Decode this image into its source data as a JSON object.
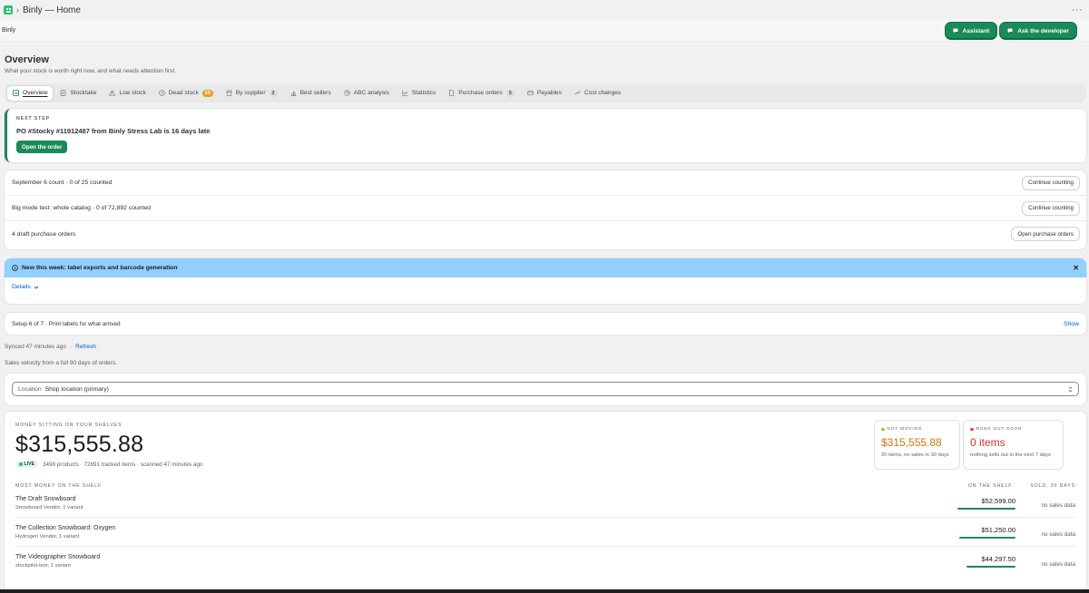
{
  "window": {
    "title": "Binly — Home"
  },
  "appbar": {
    "name": "Binly",
    "assistant_label": "Assistant",
    "developer_label": "Ask the developer"
  },
  "page": {
    "title": "Overview",
    "subtitle": "What your stock is worth right now, and what needs attention first."
  },
  "tabs": [
    {
      "label": "Overview",
      "icon": "overview-icon",
      "active": true
    },
    {
      "label": "Stocktake",
      "icon": "clipboard-icon"
    },
    {
      "label": "Low stock",
      "icon": "alert-triangle-icon"
    },
    {
      "label": "Dead stock",
      "icon": "clock-icon",
      "badge": "20"
    },
    {
      "label": "By supplier",
      "icon": "store-icon",
      "badge": "2"
    },
    {
      "label": "Best sellers",
      "icon": "bar-chart-icon"
    },
    {
      "label": "ABC analysis",
      "icon": "pie-icon"
    },
    {
      "label": "Statistics",
      "icon": "stats-icon"
    },
    {
      "label": "Purchase orders",
      "icon": "document-icon",
      "badge": "5"
    },
    {
      "label": "Payables",
      "icon": "wallet-icon"
    },
    {
      "label": "Cost changes",
      "icon": "trend-icon"
    }
  ],
  "next_step": {
    "label": "NEXT STEP",
    "title": "PO #Stocky #11912487 from Binly Stress Lab is 16 days late",
    "button": "Open the order"
  },
  "tasks": [
    {
      "text": "September 6 count · 0 of 25 counted",
      "button": "Continue counting"
    },
    {
      "text": "Big mode test: whole catalog · 0 of 72,892 counted",
      "button": "Continue counting"
    },
    {
      "text": "4 draft purchase orders",
      "button": "Open purchase orders"
    }
  ],
  "banner": {
    "title": "New this week: label exports and barcode generation",
    "details": "Details"
  },
  "setup": {
    "text": "Setup 6 of 7 · Print labels for what arrived",
    "show": "Show"
  },
  "sync": {
    "text": "Synced 47 minutes ago",
    "separator": "·",
    "refresh": "Refresh"
  },
  "velocity": "Sales velocity from a full 90 days of orders.",
  "location": {
    "label": "Location",
    "value": "Shop location (primary)"
  },
  "money": {
    "label": "MONEY SITTING ON YOUR SHELVES",
    "value": "$315,555.88",
    "live": "LIVE",
    "meta": "3498 products · 72891 tracked items · scanned 47 minutes ago",
    "not_moving": {
      "label": "NOT MOVING",
      "value": "$315,555.88",
      "note": "20 items, no sales in 30 days",
      "color": "#e0a22f"
    },
    "runs_out": {
      "label": "RUNS OUT SOON",
      "value": "0 items",
      "note": "nothing sells out in the next 7 days",
      "color": "#e0463d"
    }
  },
  "table": {
    "title": "MOST MONEY ON THE SHELF",
    "col_shelf": "ON THE SHELF",
    "col_sold": "SOLD, 30 DAYS",
    "rows": [
      {
        "name": "The Draft Snowboard",
        "sub": "Snowboard Vendor, 1 variant",
        "value": "$52,599.00",
        "sold": "no sales data",
        "share": 1.0
      },
      {
        "name": "The Collection Snowboard: Oxygen",
        "sub": "Hydrogen Vendor, 1 variant",
        "value": "$51,250.00",
        "sold": "no sales data",
        "share": 0.974
      },
      {
        "name": "The Videographer Snowboard",
        "sub": "stockpilot-test, 1 variant",
        "value": "$44,297.50",
        "sold": "no sales data",
        "share": 0.842
      }
    ]
  },
  "colors": {
    "accent": "#1a8a5a",
    "banner": "#91d0ff",
    "link": "#005bd3"
  }
}
